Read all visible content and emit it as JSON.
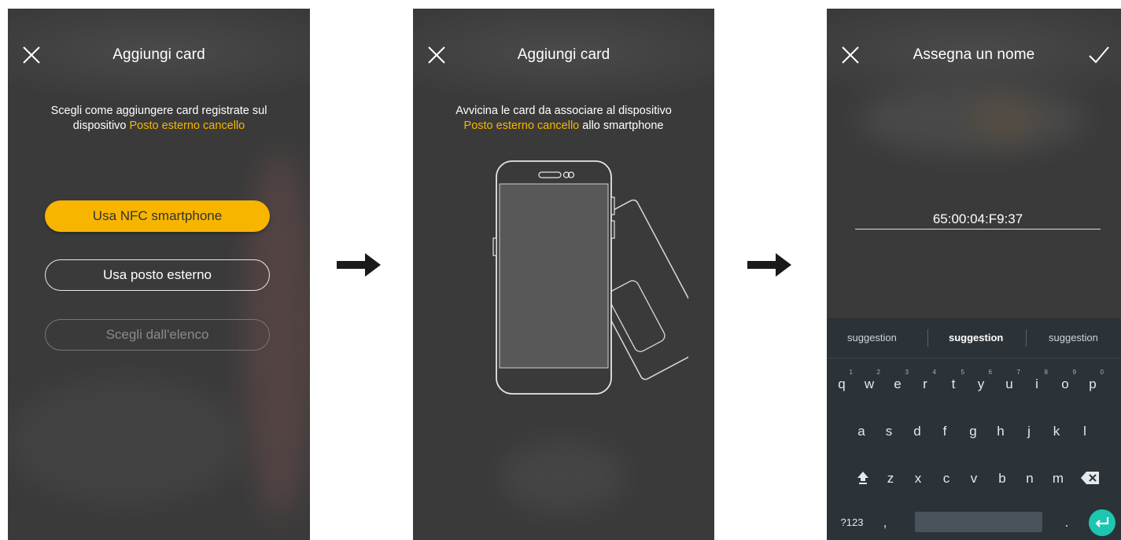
{
  "screen1": {
    "title": "Aggiungi card",
    "subtitle_part1": "Scegli come aggiungere card registrate sul",
    "subtitle_part2": "dispositivo",
    "subtitle_highlight": "Posto esterno cancello",
    "buttons": {
      "nfc": "Usa NFC smartphone",
      "esterno": "Usa posto esterno",
      "elenco": "Scegli dall'elenco"
    }
  },
  "screen2": {
    "title": "Aggiungi card",
    "line1": "Avvicina le card da associare al dispositivo",
    "highlight": "Posto esterno cancello",
    "line2_rest": "allo smartphone"
  },
  "screen3": {
    "title": "Assegna un nome",
    "name_value": "65:00:04:F9:37",
    "keyboard": {
      "suggestions": [
        "suggestion",
        "suggestion",
        "suggestion"
      ],
      "row1": [
        "q",
        "w",
        "e",
        "r",
        "t",
        "y",
        "u",
        "i",
        "o",
        "p"
      ],
      "row1_numbers": [
        "1",
        "2",
        "3",
        "4",
        "5",
        "6",
        "7",
        "8",
        "9",
        "0"
      ],
      "row2": [
        "a",
        "s",
        "d",
        "f",
        "g",
        "h",
        "j",
        "k",
        "l"
      ],
      "row3": [
        "z",
        "x",
        "c",
        "v",
        "b",
        "n",
        "m"
      ],
      "symbols_key": "?123",
      "comma": ",",
      "period": "."
    }
  },
  "colors": {
    "accent": "#f7b500",
    "background": "#3a3a3a",
    "keyboard_bg": "#2b3238",
    "enter_key": "#1ec6b0"
  }
}
